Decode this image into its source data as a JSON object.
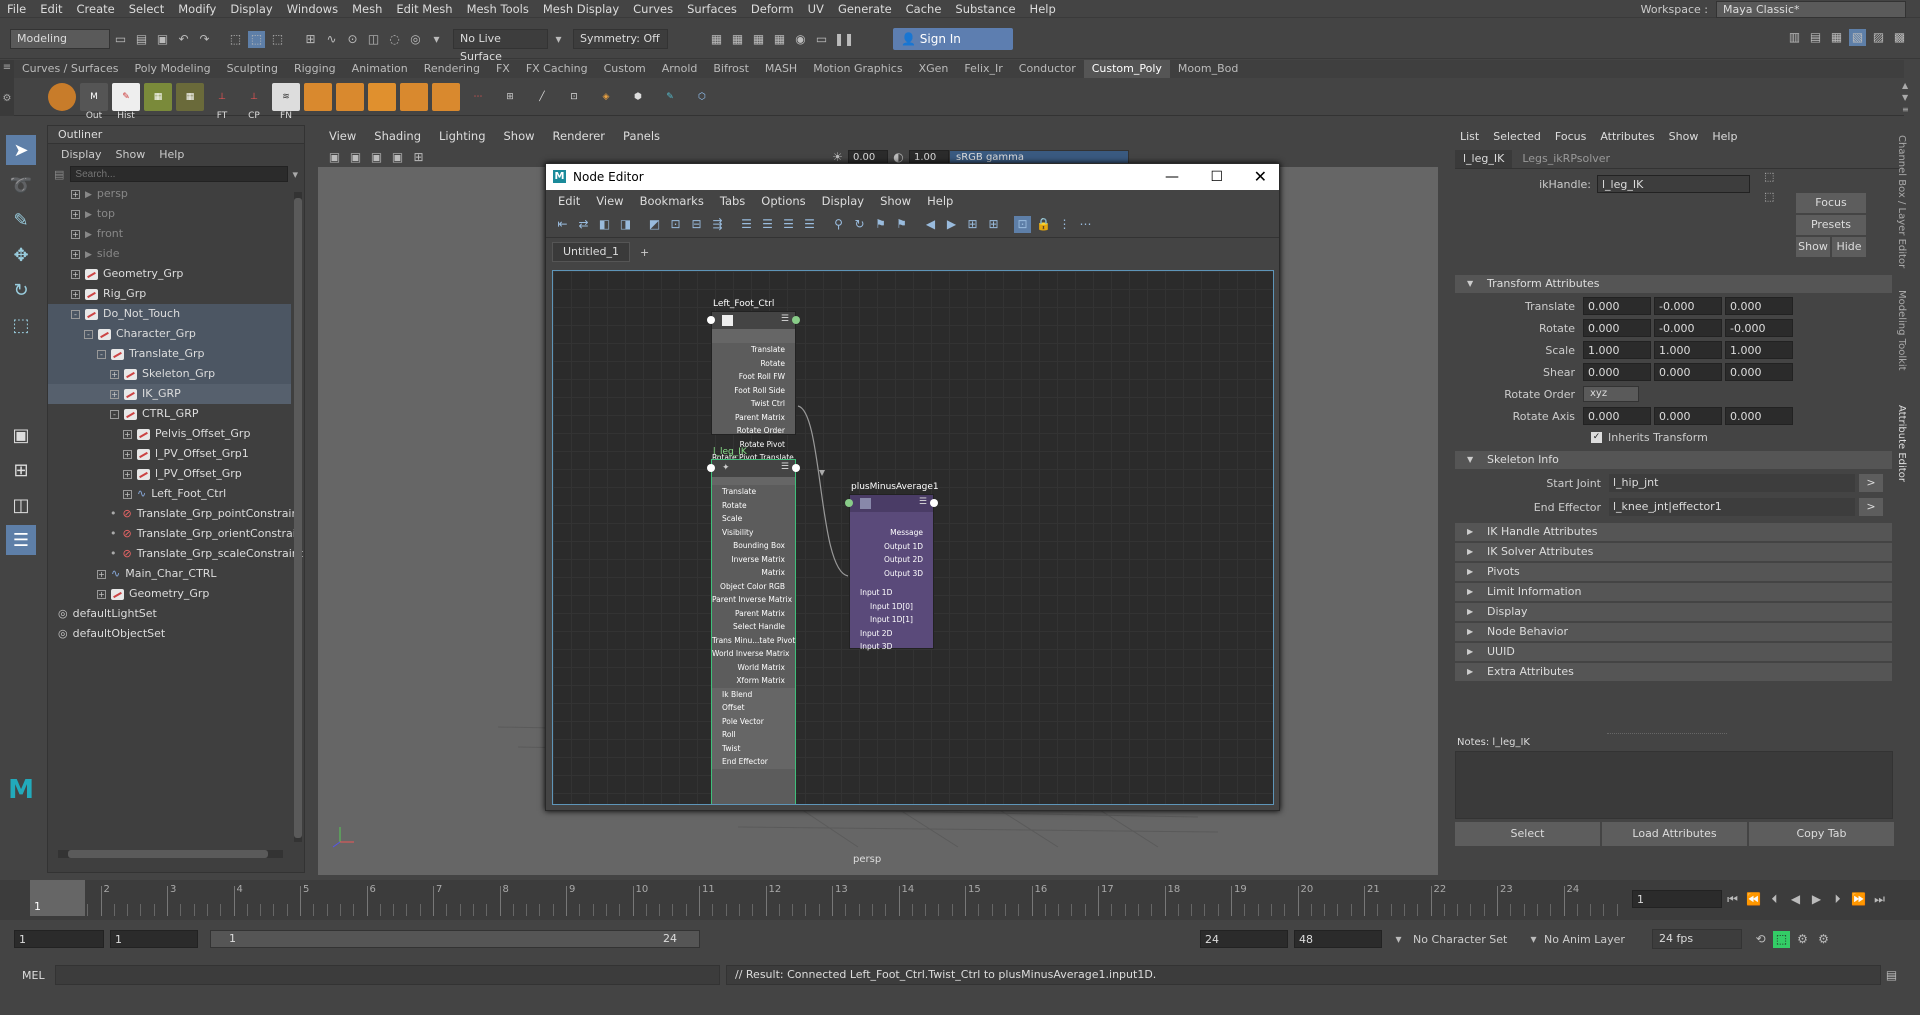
{
  "menubar": {
    "items": [
      "File",
      "Edit",
      "Create",
      "Select",
      "Modify",
      "Display",
      "Windows",
      "Mesh",
      "Edit Mesh",
      "Mesh Tools",
      "Mesh Display",
      "Curves",
      "Surfaces",
      "Deform",
      "UV",
      "Generate",
      "Cache",
      "Substance",
      "Help"
    ],
    "workspace_label": "Workspace :",
    "workspace_value": "Maya Classic*"
  },
  "toolbar": {
    "mode": "Modeling",
    "live_surface": "No Live Surface",
    "symmetry": "Symmetry: Off",
    "sign_in": "Sign In"
  },
  "shelf": {
    "tabs": [
      "Curves / Surfaces",
      "Poly Modeling",
      "Sculpting",
      "Rigging",
      "Animation",
      "Rendering",
      "FX",
      "FX Caching",
      "Custom",
      "Arnold",
      "Bifrost",
      "MASH",
      "Motion Graphics",
      "XGen",
      "Felix_Ir",
      "Conductor",
      "Custom_Poly",
      "Moom_Bod"
    ],
    "active": "Custom_Poly",
    "icon_labels": [
      "Out",
      "Hist",
      "FT",
      "CP",
      "FN"
    ]
  },
  "outliner": {
    "title": "Outliner",
    "menu": [
      "Display",
      "Show",
      "Help"
    ],
    "search_placeholder": "Search...",
    "items": [
      {
        "label": "persp"
      },
      {
        "label": "top"
      },
      {
        "label": "front"
      },
      {
        "label": "side"
      },
      {
        "label": "Geometry_Grp"
      },
      {
        "label": "Rig_Grp"
      },
      {
        "label": "Do_Not_Touch"
      },
      {
        "label": "Character_Grp"
      },
      {
        "label": "Translate_Grp"
      },
      {
        "label": "Skeleton_Grp"
      },
      {
        "label": "IK_GRP"
      },
      {
        "label": "CTRL_GRP"
      },
      {
        "label": "Pelvis_Offset_Grp"
      },
      {
        "label": "l_PV_Offset_Grp1"
      },
      {
        "label": "l_PV_Offset_Grp"
      },
      {
        "label": "Left_Foot_Ctrl"
      },
      {
        "label": "Translate_Grp_pointConstrain"
      },
      {
        "label": "Translate_Grp_orientConstrain"
      },
      {
        "label": "Translate_Grp_scaleConstraint"
      },
      {
        "label": "Main_Char_CTRL"
      },
      {
        "label": "Geometry_Grp"
      },
      {
        "label": "defaultLightSet"
      },
      {
        "label": "defaultObjectSet"
      }
    ]
  },
  "viewport": {
    "menu": [
      "View",
      "Shading",
      "Lighting",
      "Show",
      "Renderer",
      "Panels"
    ],
    "exposure": "0.00",
    "gamma": "1.00",
    "colorspace": "sRGB gamma",
    "camera": "persp"
  },
  "node_editor": {
    "title": "Node Editor",
    "menu": [
      "Edit",
      "View",
      "Bookmarks",
      "Tabs",
      "Options",
      "Display",
      "Show",
      "Help"
    ],
    "tab": "Untitled_1",
    "add_tab": "+",
    "nodes": {
      "foot": {
        "title": "Left_Foot_Ctrl",
        "attrs": [
          "Translate",
          "Rotate",
          "Foot Roll FW",
          "Foot Roll Side",
          "Twist Ctrl",
          "Parent Matrix",
          "Rotate Order",
          "Rotate Pivot",
          "Rotate Pivot Translate"
        ]
      },
      "ik": {
        "title": "l_leg_IK",
        "attrs": [
          "Translate",
          "Rotate",
          "Scale",
          "Visibility",
          "Bounding Box",
          "Inverse Matrix",
          "Matrix",
          "Object Color RGB",
          "Parent Inverse Matrix",
          "Parent Matrix",
          "Select Handle",
          "Trans Minu...tate Pivot",
          "World Inverse Matrix",
          "World Matrix",
          "Xform Matrix",
          "Ik Blend",
          "Offset",
          "Pole Vector",
          "Roll",
          "Twist",
          "End Effector"
        ]
      },
      "pma": {
        "title": "plusMinusAverage1",
        "outputs": [
          "Message",
          "Output 1D",
          "Output 2D",
          "Output 3D"
        ],
        "inputs": [
          "Input 1D",
          "Input 1D[0]",
          "Input 1D[1]",
          "Input 2D",
          "Input 3D"
        ]
      }
    }
  },
  "attribute_editor": {
    "menu": [
      "List",
      "Selected",
      "Focus",
      "Attributes",
      "Show",
      "Help"
    ],
    "tabs": [
      "l_leg_IK",
      "Legs_ikRPsolver"
    ],
    "handle_label": "ikHandle:",
    "handle_value": "l_leg_IK",
    "buttons": {
      "focus": "Focus",
      "presets": "Presets",
      "show": "Show",
      "hide": "Hide"
    },
    "transform": {
      "title": "Transform Attributes",
      "rows": [
        {
          "label": "Translate",
          "v": [
            "0.000",
            "-0.000",
            "0.000"
          ]
        },
        {
          "label": "Rotate",
          "v": [
            "0.000",
            "-0.000",
            "-0.000"
          ]
        },
        {
          "label": "Scale",
          "v": [
            "1.000",
            "1.000",
            "1.000"
          ]
        },
        {
          "label": "Shear",
          "v": [
            "0.000",
            "0.000",
            "0.000"
          ]
        }
      ],
      "rotate_order_label": "Rotate Order",
      "rotate_order": "xyz",
      "rotate_axis_label": "Rotate Axis",
      "rotate_axis": [
        "0.000",
        "0.000",
        "0.000"
      ],
      "inherits": "Inherits Transform"
    },
    "skeleton": {
      "title": "Skeleton Info",
      "start_label": "Start Joint",
      "start_value": "l_hip_jnt",
      "end_label": "End Effector",
      "end_value": "l_knee_jnt|effector1"
    },
    "sections": [
      "IK Handle Attributes",
      "IK Solver Attributes",
      "Pivots",
      "Limit Information",
      "Display",
      "Node Behavior",
      "UUID",
      "Extra Attributes"
    ],
    "notes": "Notes:  l_leg_IK",
    "bottom": [
      "Select",
      "Load Attributes",
      "Copy Tab"
    ],
    "side_tabs": [
      "Channel Box / Layer Editor",
      "Modeling Toolkit",
      "Attribute Editor"
    ]
  },
  "timeline": {
    "ticks": [
      "1",
      "2",
      "3",
      "4",
      "5",
      "6",
      "7",
      "8",
      "9",
      "10",
      "11",
      "12",
      "13",
      "14",
      "15",
      "16",
      "17",
      "18",
      "19",
      "20",
      "21",
      "22",
      "23",
      "24"
    ],
    "current": "1"
  },
  "range": {
    "start": "1",
    "start2": "1",
    "slider_start": "1",
    "slider_end": "24",
    "end": "24",
    "end2": "48",
    "char_set": "No Character Set",
    "anim_layer": "No Anim Layer",
    "fps": "24 fps"
  },
  "cmd": {
    "lang": "MEL",
    "result": "// Result: Connected Left_Foot_Ctrl.Twist_Ctrl to plusMinusAverage1.input1D."
  }
}
